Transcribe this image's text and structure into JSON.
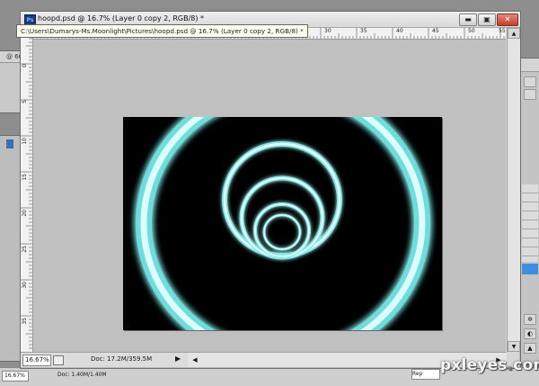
{
  "window": {
    "title": "hoopd.psd @ 16.7% (Layer 0 copy 2, RGB/8) *",
    "app_logo": "Ps",
    "buttons": {
      "minimize": "▬",
      "restore": "▣",
      "close": "✕"
    }
  },
  "tooltip": {
    "text": "C:\\Users\\Dumarys-Ms.Moonlight\\Pictures\\hoopd.psd @ 16.7% (Layer 0 copy 2, RGB/8) *"
  },
  "rulers": {
    "top_labels": [
      "10",
      "5",
      "0",
      "5",
      "10",
      "15",
      "20",
      "25",
      "30",
      "35",
      "40",
      "45",
      "50",
      "55"
    ],
    "left_labels": [
      "0",
      "5",
      "10",
      "15",
      "20",
      "25",
      "30",
      "35"
    ]
  },
  "status": {
    "zoom": "16.67%",
    "doc": "Doc: 17.2M/359.5M",
    "arrow": "▶"
  },
  "background": {
    "left_window_label": "@ 66",
    "bottom_zoom": "16.67%",
    "bottom_doc": "Doc: 1.40M/1.40M",
    "find_box": "Rep"
  },
  "hscroll": {
    "left_arrow": "◀",
    "right_arrow": "▶"
  },
  "vscroll": {
    "up_arrow": "▲",
    "down_arrow": "▼"
  },
  "watermark": {
    "name": "pxleyes",
    "dot": ".",
    "tld": "com"
  },
  "image": {
    "description_colors": {
      "glow": "#7fe7e7",
      "core": "#e9ffff",
      "background": "#000000"
    }
  }
}
